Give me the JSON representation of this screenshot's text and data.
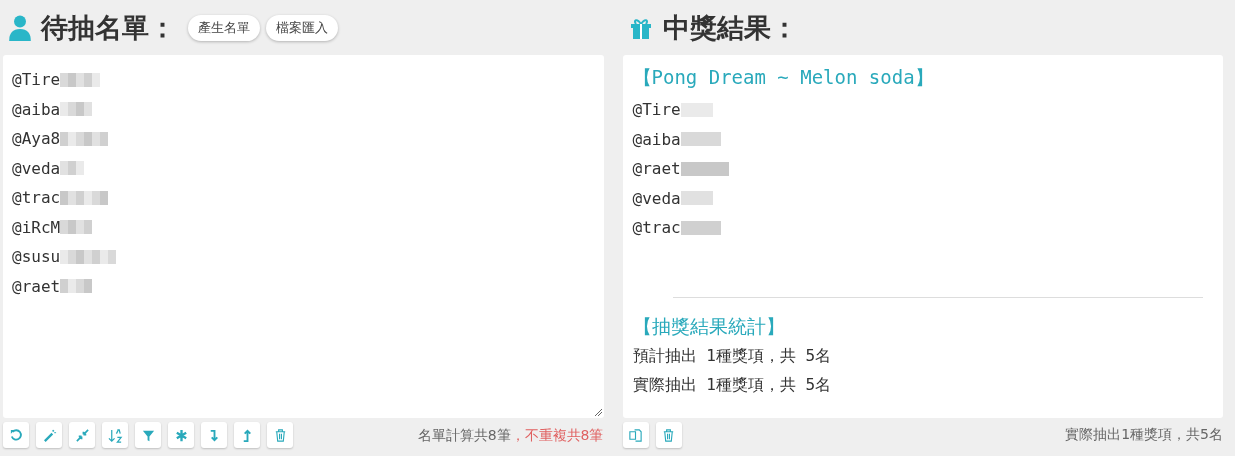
{
  "candidates": {
    "title": "待抽名單：",
    "buttons": [
      "產生名單",
      "檔案匯入"
    ],
    "names": [
      "@Tire",
      "@aiba",
      "@Aya8",
      "@veda",
      "@trac",
      "@iRcM",
      "@susu",
      "@raet"
    ],
    "count_total": "名單計算共8筆",
    "count_unique": "，不重複共8筆"
  },
  "results": {
    "title": "中獎結果：",
    "prize_title": "【Pong Dream ~ Melon soda】",
    "winners": [
      "@Tire",
      "@aiba",
      "@raet",
      "@veda",
      "@trac"
    ],
    "stats_title": "【抽獎結果統計】",
    "stats": [
      "預計抽出 1種獎項，共 5名",
      "實際抽出 1種獎項，共 5名"
    ],
    "summary": "實際抽出1種獎項，共5名"
  }
}
